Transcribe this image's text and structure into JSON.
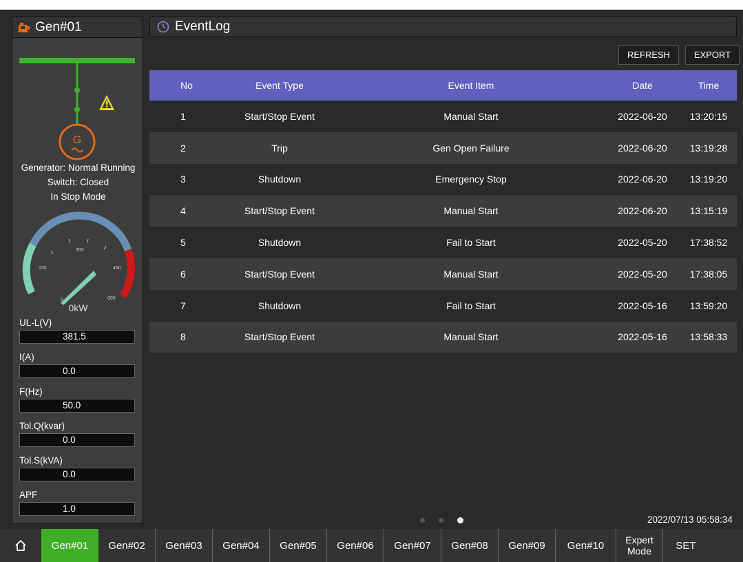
{
  "left_panel": {
    "gen_name": "Gen#01",
    "status_lines": [
      "Generator: Normal Running",
      "Switch: Closed",
      "In Stop Mode"
    ],
    "gauge": {
      "ticks": [
        "0",
        "150",
        "300",
        "450",
        "600"
      ],
      "value_label": "0kW",
      "colors": {
        "low": "#7fd1b0",
        "mid": "#6a8fb5",
        "high": "#cc1a1a"
      }
    },
    "meters": [
      {
        "label": "UL-L(V)",
        "value": "381.5"
      },
      {
        "label": "I(A)",
        "value": "0.0"
      },
      {
        "label": "F(Hz)",
        "value": "50.0"
      },
      {
        "label": "Tol.Q(kvar)",
        "value": "0.0"
      },
      {
        "label": "Tol.S(kVA)",
        "value": "0.0"
      },
      {
        "label": "APF",
        "value": "1.0"
      }
    ],
    "colors": {
      "bus": "#3cb32b",
      "generator": "#e06a1a",
      "warning": "#f2e01a"
    },
    "generator_symbol": "G"
  },
  "main": {
    "title": "EventLog",
    "buttons": {
      "refresh": "REFRESH",
      "export": "EXPORT"
    },
    "table": {
      "headers": [
        "No",
        "Event Type",
        "Event Item",
        "Date",
        "Time"
      ],
      "rows": [
        [
          "1",
          "Start/Stop Event",
          "Manual Start",
          "2022-06-20",
          "13:20:15"
        ],
        [
          "2",
          "Trip",
          "Gen Open Failure",
          "2022-06-20",
          "13:19:28"
        ],
        [
          "3",
          "Shutdown",
          "Emergency Stop",
          "2022-06-20",
          "13:19:20"
        ],
        [
          "4",
          "Start/Stop Event",
          "Manual Start",
          "2022-06-20",
          "13:15:19"
        ],
        [
          "5",
          "Shutdown",
          "Fail to Start",
          "2022-05-20",
          "17:38:52"
        ],
        [
          "6",
          "Start/Stop Event",
          "Manual Start",
          "2022-05-20",
          "17:38:05"
        ],
        [
          "7",
          "Shutdown",
          "Fail to Start",
          "2022-05-16",
          "13:59:20"
        ],
        [
          "8",
          "Start/Stop Event",
          "Manual Start",
          "2022-05-16",
          "13:58:33"
        ]
      ]
    },
    "pagination": {
      "pages": 3,
      "current": 3
    },
    "datetime": "2022/07/13 05:58:34",
    "header_color": "#6060c0"
  },
  "nav": {
    "items": [
      "Gen#01",
      "Gen#02",
      "Gen#03",
      "Gen#04",
      "Gen#05",
      "Gen#06",
      "Gen#07",
      "Gen#08",
      "Gen#09",
      "Gen#10"
    ],
    "active": "Gen#01",
    "expert_line1": "Expert",
    "expert_line2": "Mode",
    "set": "SET",
    "active_color": "#3fae27"
  }
}
